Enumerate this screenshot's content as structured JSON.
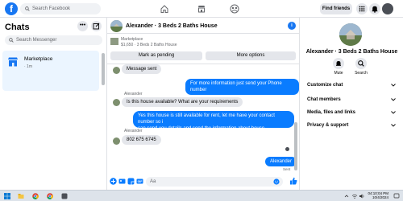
{
  "topbar": {
    "logo": "f",
    "search_placeholder": "Search Facebook",
    "find_friends": "Find friends",
    "colors": {
      "brand": "#1877f2"
    }
  },
  "sidebar": {
    "title": "Chats",
    "search_placeholder": "Search Messenger",
    "conversations": [
      {
        "name": "Marketplace",
        "time": "· 1m"
      }
    ]
  },
  "chat": {
    "title": "Alexander · 3 Beds 2 Baths House",
    "marketplace": {
      "label": "Marketplace",
      "listing": "$1,650 · 3 Beds 2 Baths House",
      "mark_pending": "Mark as pending",
      "more_options": "More options"
    },
    "messages": [
      {
        "id": "m0",
        "dir": "in",
        "text": "Message sent"
      },
      {
        "id": "m1",
        "dir": "out",
        "text": "For more information just send your Phone number"
      },
      {
        "id": "m2",
        "dir": "in",
        "sender": "Alexander",
        "text": "Is this house available? What are your requirements"
      },
      {
        "id": "m3",
        "dir": "out",
        "text_line1": "Yes this house is still available for rent, let me have your contact number so i",
        "text_line2": "can send you details and send the information about house."
      },
      {
        "id": "m4",
        "dir": "in",
        "sender": "Alexander",
        "text": "802 675 6745"
      },
      {
        "id": "m5",
        "dir": "out",
        "text": "Alexander"
      }
    ],
    "sent_status": "Sent",
    "composer_placeholder": "Aa"
  },
  "rightpanel": {
    "name": "Alexander · 3 Beds 2 Baths House",
    "actions": [
      {
        "label": "Mute"
      },
      {
        "label": "Search"
      }
    ],
    "sections": [
      {
        "label": "Customize chat"
      },
      {
        "label": "Chat members"
      },
      {
        "label": "Media, files and links"
      },
      {
        "label": "Privacy & support"
      }
    ]
  },
  "taskbar": {
    "time": "04:10:04 PM",
    "date": "10/4/2024"
  }
}
